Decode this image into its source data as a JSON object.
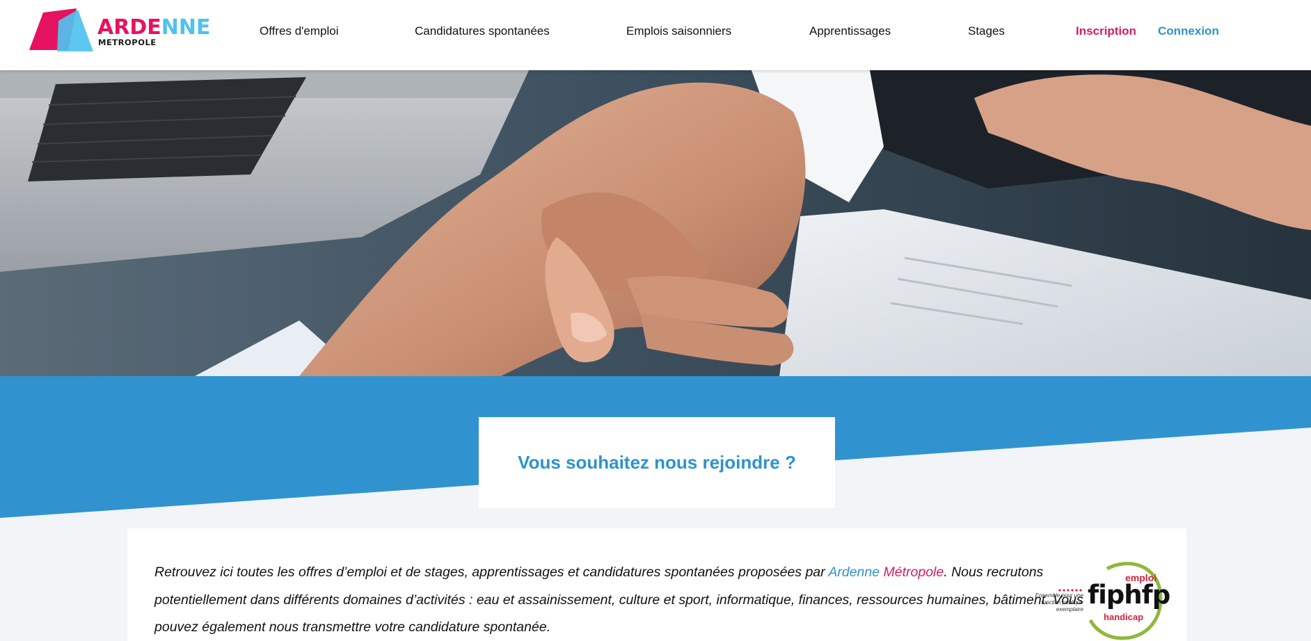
{
  "logo": {
    "word_part1": "ARDE",
    "word_part2": "NNE",
    "sub": "METROPOLE"
  },
  "nav": {
    "items": [
      "Offres d'emploi",
      "Candidatures spontanées",
      "Emplois saisonniers",
      "Apprentissages",
      "Stages"
    ],
    "signup": "Inscription",
    "login": "Connexion"
  },
  "hero": {
    "image_subject": "handshake-photo"
  },
  "section": {
    "title": "Vous souhaitez nous rejoindre ?"
  },
  "intro": {
    "text_before": "Retrouvez ici toutes les offres d’emploi et de stages, apprentissages et candidatures spontanées proposées par ",
    "brand_part1": "Ardenne",
    "brand_part2": "Métropole",
    "text_after": ". Nous recrutons potentiellement dans différents domaines d’activités : eau et assainissement, culture et sport, informatique, finances, ressources humaines, bâtiment. Vous pouvez également nous transmettre votre candidature spontanée."
  },
  "fiphfp": {
    "brand": "fiphfp",
    "top": "emploi",
    "bottom": "handicap",
    "tagline": "Ensemble pour une fonction publique exemplaire"
  },
  "colors": {
    "brand_pink": "#d81b60",
    "brand_blue": "#2d93cd",
    "band_blue": "#3093cf",
    "logo_cyan": "#4fc2ef"
  }
}
